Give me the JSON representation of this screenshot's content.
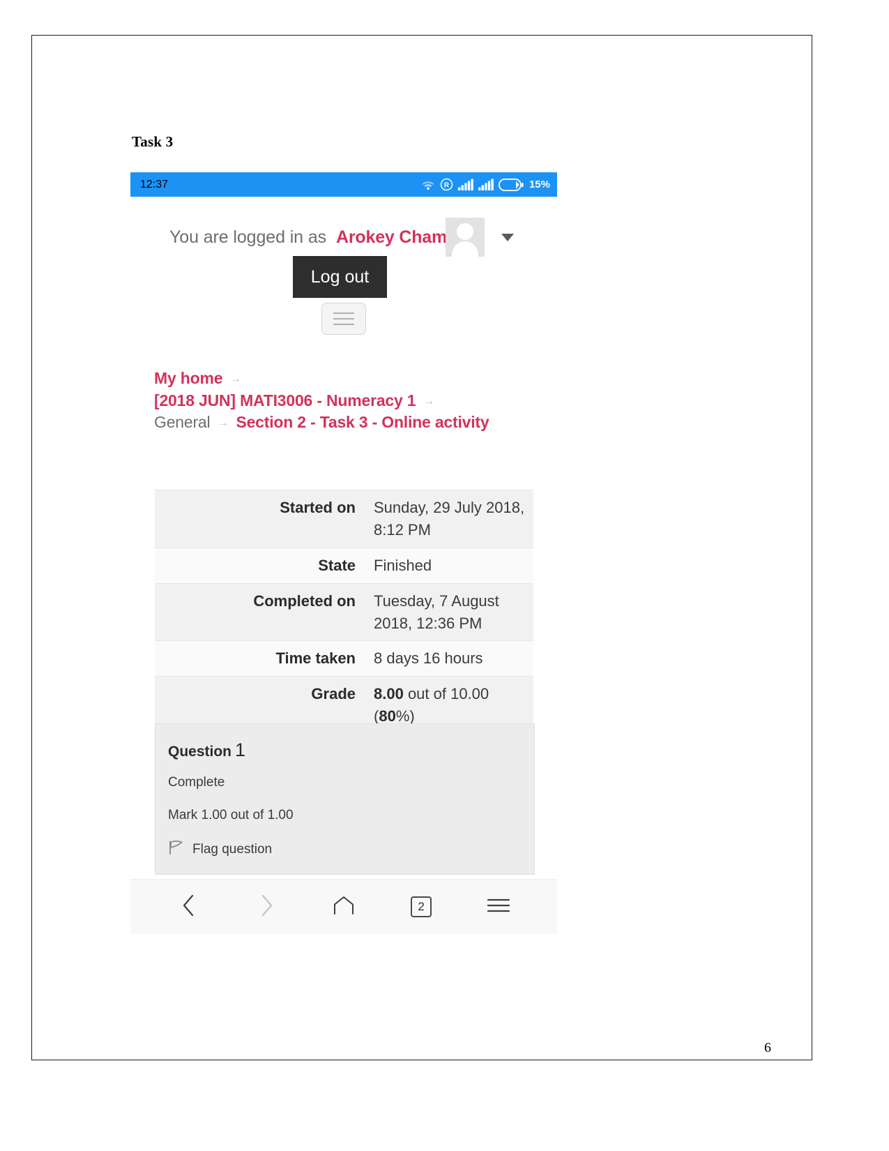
{
  "document": {
    "task_heading": "Task 3",
    "page_number": "6"
  },
  "phone": {
    "status_bar": {
      "clock": "12:37",
      "battery_percent": "15%",
      "icons": [
        "wifi-icon",
        "roaming-icon",
        "signal-bars-icon",
        "signal-bars-icon",
        "battery-icon"
      ]
    },
    "bottom_nav": {
      "back_label": "back-icon",
      "forward_label": "forward-icon",
      "home_label": "home-icon",
      "tabs_count": "2",
      "menu_label": "menu-icon"
    }
  },
  "moodle": {
    "login_prefix": "You are logged in as",
    "user_name": "Arokey Cham",
    "logout_label": "Log out",
    "breadcrumb": [
      {
        "label": "My home",
        "link": true
      },
      {
        "label": "[2018 JUN] MATI3006 - Numeracy 1",
        "link": true
      },
      {
        "label": "General",
        "link": false
      },
      {
        "label": "Section 2 - Task 3 - Online activity",
        "link": true
      }
    ],
    "breadcrumb_separator": "→",
    "summary": {
      "rows": [
        {
          "key": "Started on",
          "value": "Sunday, 29 July 2018, 8:12 PM"
        },
        {
          "key": "State",
          "value": "Finished"
        },
        {
          "key": "Completed on",
          "value": "Tuesday, 7 August 2018, 12:36 PM"
        },
        {
          "key": "Time taken",
          "value": "8 days 16 hours"
        }
      ],
      "grade": {
        "key": "Grade",
        "score": "8.00",
        "middle": " out of 10.00",
        "open_paren": "(",
        "percent": "80",
        "close_paren": "%)"
      }
    },
    "question": {
      "title": "Question",
      "number": "1",
      "state": "Complete",
      "mark": "Mark 1.00 out of 1.00",
      "flag_label": "Flag question"
    }
  },
  "colors": {
    "status_bar_blue": "#1d92f5",
    "moodle_crimson": "#d1335b",
    "logout_dark": "#2e2e2e",
    "card_grey": "#ececec",
    "blue_panel": "#dceef5"
  }
}
